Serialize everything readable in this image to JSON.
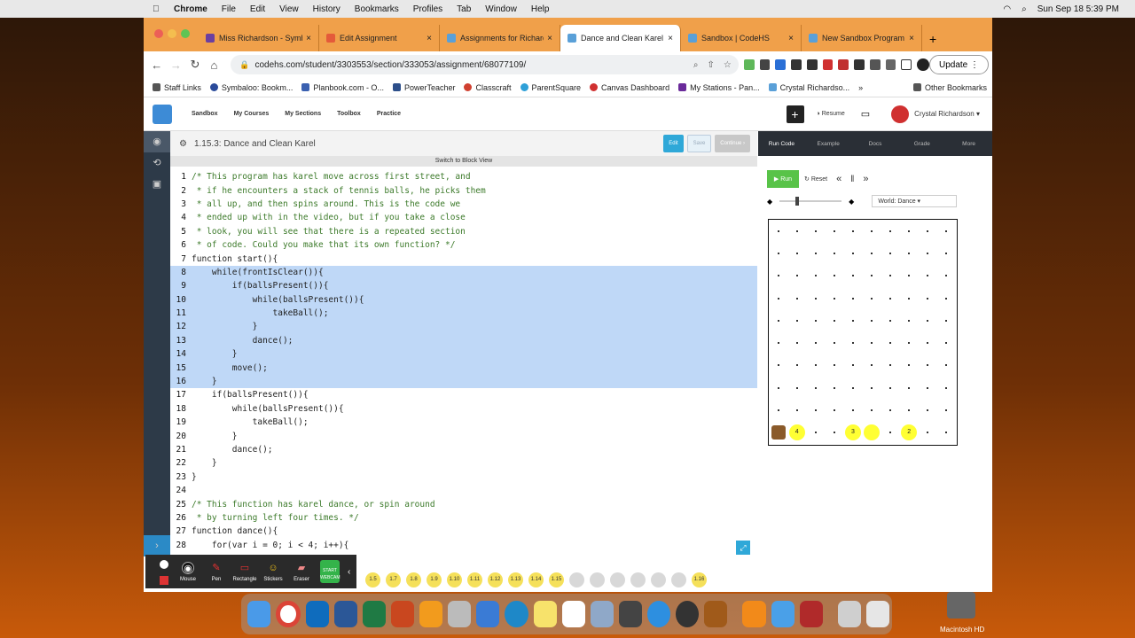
{
  "menubar": {
    "apple": "",
    "app": "Chrome",
    "items": [
      "File",
      "Edit",
      "View",
      "History",
      "Bookmarks",
      "Profiles",
      "Tab",
      "Window",
      "Help"
    ],
    "datetime": "Sun Sep 18  5:39 PM"
  },
  "tabs": [
    {
      "label": "Miss Richardson - Symb",
      "active": false
    },
    {
      "label": "Edit Assignment",
      "active": false
    },
    {
      "label": "Assignments for Richardson",
      "active": false
    },
    {
      "label": "Dance and Clean Karel | CodeHS",
      "active": true
    },
    {
      "label": "Sandbox | CodeHS",
      "active": false
    },
    {
      "label": "New Sandbox Program | CodeHS",
      "active": false
    }
  ],
  "toolbar": {
    "url": "codehs.com/student/3303553/section/333053/assignment/68077109/",
    "update": "Update"
  },
  "bookmarks": [
    "Staff Links",
    "Symbaloo: Bookm...",
    "Planbook.com - O...",
    "PowerTeacher",
    "Classcraft",
    "ParentSquare",
    "Canvas Dashboard",
    "My Stations - Pan...",
    "Crystal Richardso..."
  ],
  "bookmarks_more": "»",
  "other_bookmarks": "Other Bookmarks",
  "codehs_nav": {
    "items": [
      "Sandbox",
      "My Courses",
      "My Sections",
      "Toolbox",
      "Practice"
    ],
    "resume": "Resume",
    "user": "Crystal Richardson"
  },
  "editor": {
    "title": "1.15.3: Dance and Clean Karel",
    "edit": "Edit",
    "save": "Save",
    "continue": "Continue",
    "switch": "Switch to Block View"
  },
  "code": [
    "/* This program has karel move across first street, and",
    " * if he encounters a stack of tennis balls, he picks them",
    " * all up, and then spins around. This is the code we",
    " * ended up with in the video, but if you take a close",
    " * look, you will see that there is a repeated section",
    " * of code. Could you make that its own function? */",
    "function start(){",
    "    while(frontIsClear()){",
    "        if(ballsPresent()){",
    "            while(ballsPresent()){",
    "                takeBall();",
    "            }",
    "            dance();",
    "        }",
    "        move();",
    "    }",
    "    if(ballsPresent()){",
    "        while(ballsPresent()){",
    "            takeBall();",
    "        }",
    "        dance();",
    "    }",
    "}",
    "",
    "/* This function has karel dance, or spin around",
    " * by turning left four times. */",
    "function dance(){",
    "    for(var i = 0; i < 4; i++){"
  ],
  "selected_lines": [
    8,
    16
  ],
  "right": {
    "tabs": [
      "Run Code",
      "Example",
      "Docs",
      "Grade",
      "More"
    ],
    "run": "Run",
    "reset": "Reset",
    "world": "World: Dance"
  },
  "world": {
    "cols": 10,
    "rows": 10,
    "balls": [
      {
        "col": 1,
        "label": "4"
      },
      {
        "col": 4,
        "label": "3"
      },
      {
        "col": 5,
        "label": ""
      },
      {
        "col": 7,
        "label": "2"
      }
    ]
  },
  "overlay": {
    "tools": [
      "Mouse",
      "Pen",
      "Rectangle",
      "Stickers",
      "Eraser",
      "START WEBCAM"
    ]
  },
  "bubbles": [
    "1.5",
    "1.7",
    "1.8",
    "1.9",
    "1.10",
    "1.11",
    "1.12",
    "1.13",
    "1.14",
    "1.15",
    "",
    "",
    "",
    "",
    "",
    "",
    "1.16"
  ],
  "disk": "Macintosh HD"
}
